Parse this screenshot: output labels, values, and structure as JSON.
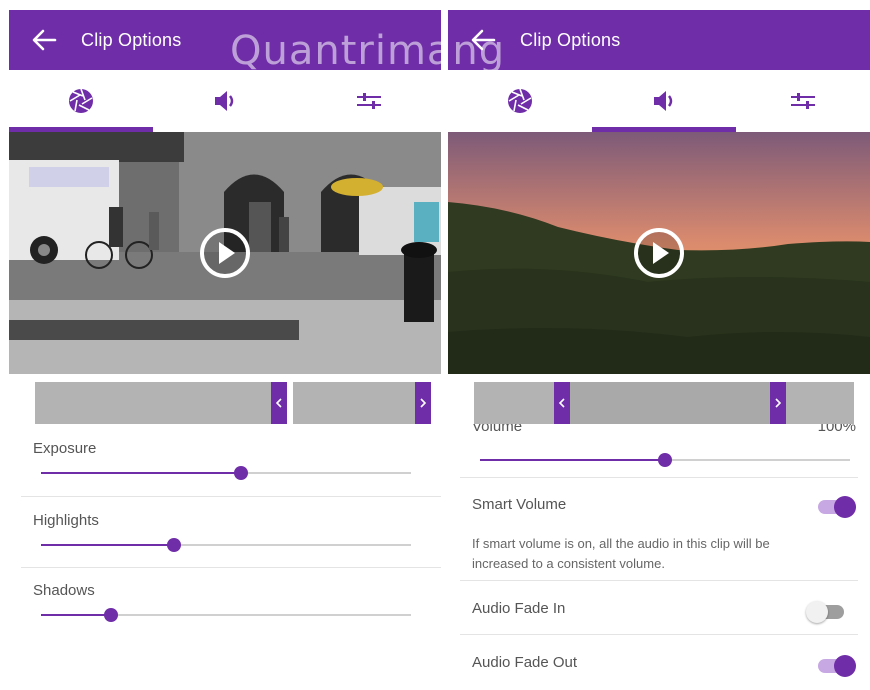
{
  "left": {
    "appbar": {
      "title": "Clip Options",
      "back_icon": "arrow-left-icon"
    },
    "tabs": [
      {
        "name": "aperture-icon",
        "active": true
      },
      {
        "name": "speaker-icon",
        "active": false
      },
      {
        "name": "sliders-icon",
        "active": false
      }
    ],
    "sliders": [
      {
        "label": "Exposure",
        "value": 0.54
      },
      {
        "label": "Highlights",
        "value": 0.36
      },
      {
        "label": "Shadows",
        "value": 0.19
      }
    ]
  },
  "right": {
    "appbar": {
      "title": "Clip Options",
      "back_icon": "arrow-left-icon"
    },
    "tabs": [
      {
        "name": "aperture-icon",
        "active": false
      },
      {
        "name": "speaker-icon",
        "active": true
      },
      {
        "name": "sliders-icon",
        "active": false
      }
    ],
    "volume": {
      "label": "Volume",
      "value_text": "100%",
      "value": 0.5
    },
    "smart_volume": {
      "label": "Smart Volume",
      "on": true,
      "description_line1": "If smart volume is on, all the audio in this clip will be",
      "description_line2": "increased to a consistent volume."
    },
    "fade_in": {
      "label": "Audio Fade In",
      "on": false
    },
    "fade_out": {
      "label": "Audio Fade Out",
      "on": true
    }
  },
  "watermark": "Quantrimang",
  "colors": {
    "accent": "#6f2da8",
    "accent_light": "#c7a8e3"
  }
}
